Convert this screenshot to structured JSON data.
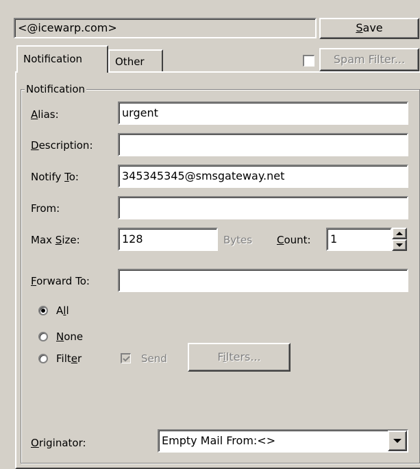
{
  "header": {
    "account": "<@icewarp.com>",
    "save_pre": "",
    "save_key": "S",
    "save_post": "ave"
  },
  "tabs": [
    {
      "label": "Notification",
      "active": true
    },
    {
      "label": "Other",
      "active": false
    }
  ],
  "spam": {
    "checked": false,
    "button_label": "Spam Filter..."
  },
  "group": {
    "title": "Notification"
  },
  "fields": {
    "alias": {
      "pre": "",
      "key": "A",
      "post": "lias:",
      "value": "urgent"
    },
    "description": {
      "pre": "",
      "key": "D",
      "post": "escription:",
      "value": ""
    },
    "notify_to": {
      "pre": "Notify ",
      "key": "T",
      "post": "o:",
      "value": "345345345@smsgateway.net"
    },
    "from": {
      "pre": "From:",
      "key": "",
      "post": "",
      "value": ""
    },
    "max_size": {
      "pre": "Max ",
      "key": "S",
      "post": "ize:",
      "value": "128",
      "unit": "Bytes"
    },
    "count": {
      "pre": "",
      "key": "C",
      "post": "ount:",
      "value": "1"
    },
    "forward_to": {
      "pre": "",
      "key": "F",
      "post": "orward To:",
      "value": ""
    }
  },
  "radios": {
    "all": {
      "pre": "A",
      "key": "l",
      "post": "l",
      "selected": true
    },
    "none": {
      "pre": "",
      "key": "N",
      "post": "one",
      "selected": false
    },
    "filter": {
      "pre": "Filt",
      "key": "e",
      "post": "r",
      "selected": false
    }
  },
  "send": {
    "label": "Send",
    "checked": true
  },
  "filters_button": {
    "pre": "F",
    "key": "i",
    "post": "lters..."
  },
  "originator": {
    "label_pre": "",
    "label_key": "O",
    "label_post": "riginator:",
    "selected": "Empty Mail From:<>"
  },
  "colors": {
    "window": "#d4d0c8",
    "field": "#ffffff",
    "disabled": "#808080"
  }
}
